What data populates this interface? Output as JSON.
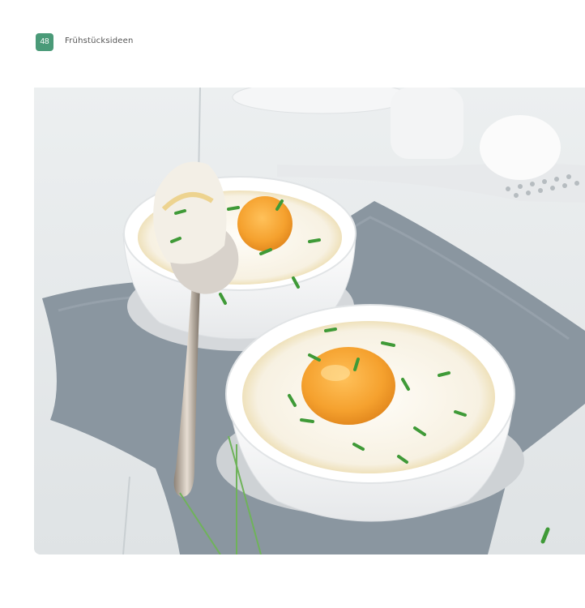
{
  "page": {
    "number": "48",
    "section_title": "Frühstücksideen"
  },
  "colors": {
    "accent": "#4a9a78",
    "header_text": "#555555"
  },
  "photo": {
    "subject": "egg-ramekins-photo"
  }
}
